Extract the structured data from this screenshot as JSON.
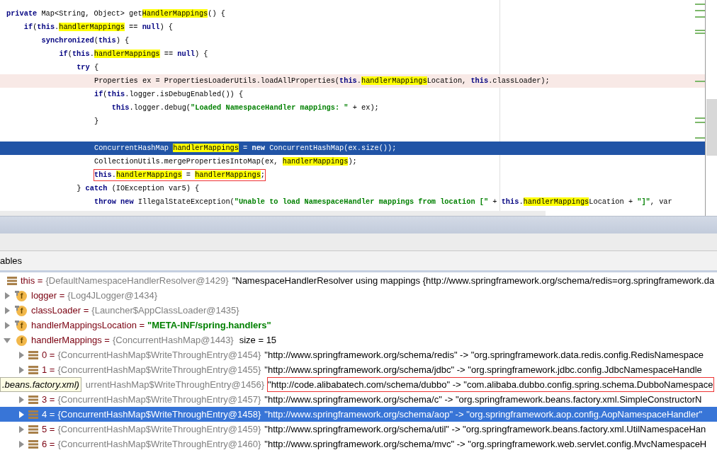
{
  "editor": {
    "lines": [
      {
        "selected": false,
        "execution": false,
        "boxed": false,
        "tokens": [
          {
            "kind": "kw",
            "text": "private"
          },
          {
            "kind": "plain",
            "text": " Map<String, Object> get"
          },
          {
            "kind": "hl",
            "text": "HandlerMappings"
          },
          {
            "kind": "plain",
            "text": "() {"
          }
        ],
        "children": [
          {
            "selected": false,
            "execution": false,
            "boxed": false,
            "tokens": [
              {
                "kind": "kw",
                "text": "if"
              },
              {
                "kind": "plain",
                "text": "("
              },
              {
                "kind": "kw",
                "text": "this"
              },
              {
                "kind": "plain",
                "text": "."
              },
              {
                "kind": "hl",
                "text": "handlerMappings"
              },
              {
                "kind": "plain",
                "text": " == "
              },
              {
                "kind": "kw",
                "text": "null"
              },
              {
                "kind": "plain",
                "text": ") {"
              }
            ],
            "children": [
              {
                "selected": false,
                "execution": false,
                "boxed": false,
                "tokens": [
                  {
                    "kind": "kw",
                    "text": "synchronized"
                  },
                  {
                    "kind": "plain",
                    "text": "("
                  },
                  {
                    "kind": "kw",
                    "text": "this"
                  },
                  {
                    "kind": "plain",
                    "text": ") {"
                  }
                ],
                "children": [
                  {
                    "selected": false,
                    "execution": false,
                    "boxed": false,
                    "tokens": [
                      {
                        "kind": "kw",
                        "text": "if"
                      },
                      {
                        "kind": "plain",
                        "text": "("
                      },
                      {
                        "kind": "kw",
                        "text": "this"
                      },
                      {
                        "kind": "plain",
                        "text": "."
                      },
                      {
                        "kind": "hl",
                        "text": "handlerMappings"
                      },
                      {
                        "kind": "plain",
                        "text": " == "
                      },
                      {
                        "kind": "kw",
                        "text": "null"
                      },
                      {
                        "kind": "plain",
                        "text": ") {"
                      }
                    ],
                    "children": [
                      {
                        "selected": false,
                        "execution": false,
                        "boxed": false,
                        "tokens": [
                          {
                            "kind": "kw",
                            "text": "try"
                          },
                          {
                            "kind": "plain",
                            "text": " {"
                          }
                        ],
                        "children": [
                          {
                            "selected": false,
                            "execution": true,
                            "boxed": false,
                            "tokens": [
                              {
                                "kind": "plain",
                                "text": "Properties ex = PropertiesLoaderUtils.loadAllProperties("
                              },
                              {
                                "kind": "kw",
                                "text": "this"
                              },
                              {
                                "kind": "plain",
                                "text": "."
                              },
                              {
                                "kind": "hl",
                                "text": "handlerMappings"
                              },
                              {
                                "kind": "plain",
                                "text": "Location, "
                              },
                              {
                                "kind": "kw",
                                "text": "this"
                              },
                              {
                                "kind": "plain",
                                "text": ".classLoader);"
                              }
                            ]
                          },
                          {
                            "selected": false,
                            "execution": false,
                            "boxed": false,
                            "tokens": [
                              {
                                "kind": "kw",
                                "text": "if"
                              },
                              {
                                "kind": "plain",
                                "text": "("
                              },
                              {
                                "kind": "kw",
                                "text": "this"
                              },
                              {
                                "kind": "plain",
                                "text": ".logger.isDebugEnabled()) {"
                              }
                            ],
                            "children": [
                              {
                                "selected": false,
                                "execution": false,
                                "boxed": false,
                                "tokens": [
                                  {
                                    "kind": "kw",
                                    "text": "this"
                                  },
                                  {
                                    "kind": "plain",
                                    "text": ".logger.debug("
                                  },
                                  {
                                    "kind": "str",
                                    "text": "\"Loaded NamespaceHandler mappings: \""
                                  },
                                  {
                                    "kind": "plain",
                                    "text": " + ex);"
                                  }
                                ]
                              }
                            ]
                          },
                          {
                            "selected": false,
                            "execution": false,
                            "boxed": false,
                            "tokens": [
                              {
                                "kind": "plain",
                                "text": "}"
                              }
                            ]
                          },
                          {
                            "selected": false,
                            "execution": false,
                            "boxed": false
                          },
                          {
                            "selected": true,
                            "execution": false,
                            "boxed": false,
                            "tokens": [
                              {
                                "kind": "plain",
                                "text": "ConcurrentHashMap "
                              },
                              {
                                "kind": "hl",
                                "text": "handlerMappings"
                              },
                              {
                                "kind": "plain",
                                "text": " = "
                              },
                              {
                                "kind": "kw",
                                "text": "new"
                              },
                              {
                                "kind": "plain",
                                "text": " ConcurrentHashMap(ex.size());"
                              }
                            ]
                          },
                          {
                            "selected": false,
                            "execution": false,
                            "boxed": false,
                            "tokens": [
                              {
                                "kind": "plain",
                                "text": "CollectionUtils.mergePropertiesIntoMap(ex, "
                              },
                              {
                                "kind": "hl",
                                "text": "handlerMappings"
                              },
                              {
                                "kind": "plain",
                                "text": ");"
                              }
                            ]
                          },
                          {
                            "selected": false,
                            "execution": false,
                            "boxed": true,
                            "tokens": [
                              {
                                "kind": "kw",
                                "text": "this"
                              },
                              {
                                "kind": "plain",
                                "text": "."
                              },
                              {
                                "kind": "hl",
                                "text": "handlerMappings"
                              },
                              {
                                "kind": "plain",
                                "text": " = "
                              },
                              {
                                "kind": "hl",
                                "text": "handlerMappings"
                              },
                              {
                                "kind": "plain",
                                "text": ";"
                              }
                            ]
                          }
                        ]
                      },
                      {
                        "selected": false,
                        "execution": false,
                        "boxed": false,
                        "tokens": [
                          {
                            "kind": "plain",
                            "text": "} "
                          },
                          {
                            "kind": "kw",
                            "text": "catch"
                          },
                          {
                            "kind": "plain",
                            "text": " (IOException var5) {"
                          }
                        ],
                        "children": [
                          {
                            "selected": false,
                            "execution": false,
                            "boxed": false,
                            "tokens": [
                              {
                                "kind": "kw",
                                "text": "throw new"
                              },
                              {
                                "kind": "plain",
                                "text": " IllegalStateException("
                              },
                              {
                                "kind": "str",
                                "text": "\"Unable to load NamespaceHandler mappings from location [\""
                              },
                              {
                                "kind": "plain",
                                "text": " + "
                              },
                              {
                                "kind": "kw",
                                "text": "this"
                              },
                              {
                                "kind": "plain",
                                "text": "."
                              },
                              {
                                "kind": "hl",
                                "text": "handlerMappings"
                              },
                              {
                                "kind": "plain",
                                "text": "Location + "
                              },
                              {
                                "kind": "str",
                                "text": "\"]\""
                              },
                              {
                                "kind": "plain",
                                "text": ", var"
                              }
                            ]
                          }
                        ]
                      }
                    ]
                  }
                ]
              }
            ]
          }
        ]
      }
    ]
  },
  "variables": {
    "title": "ables",
    "rows": [
      {
        "kind": "object",
        "selected": false,
        "boxed": false,
        "name": "this =",
        "type": "{DefaultNamespaceHandlerResolver@1429}",
        "value": "\"NamespaceHandlerResolver using mappings {http://www.springframework.org/schema/redis=org.springframework.da"
      },
      {
        "kind": "field",
        "badge": "f",
        "final": true,
        "expanded": false,
        "selected": false,
        "boxed": false,
        "name": "logger =",
        "type": "{Log4JLogger@1434}"
      },
      {
        "kind": "field",
        "badge": "f",
        "final": true,
        "expanded": false,
        "selected": false,
        "boxed": false,
        "name": "classLoader =",
        "type": "{Launcher$AppClassLoader@1435}"
      },
      {
        "kind": "field",
        "badge": "f",
        "final": true,
        "expanded": false,
        "selected": false,
        "boxed": false,
        "name": "handlerMappingsLocation =",
        "string": "\"META-INF/spring.handlers\""
      },
      {
        "kind": "field",
        "badge": "f",
        "final": false,
        "expanded": true,
        "selected": false,
        "boxed": false,
        "name": "handlerMappings =",
        "type": "{ConcurrentHashMap@1443}",
        "extra": "size = 15",
        "children": [
          {
            "kind": "object",
            "expanded": false,
            "selected": false,
            "boxed": false,
            "name": "0 =",
            "type": "{ConcurrentHashMap$WriteThroughEntry@1454}",
            "value": "\"http://www.springframework.org/schema/redis\" -> \"org.springframework.data.redis.config.RedisNamespace"
          },
          {
            "kind": "object",
            "expanded": false,
            "selected": false,
            "boxed": false,
            "name": "1 =",
            "type": "{ConcurrentHashMap$WriteThroughEntry@1455}",
            "value": "\"http://www.springframework.org/schema/jdbc\" -> \"org.springframework.jdbc.config.JdbcNamespaceHandle"
          },
          {
            "tooltip": ".beans.factory.xml)",
            "selected": false,
            "boxed": true,
            "type": "urrentHashMap$WriteThroughEntry@1456}",
            "value": "\"http://code.alibabatech.com/schema/dubbo\" -> \"com.alibaba.dubbo.config.spring.schema.DubboNamespace"
          },
          {
            "kind": "object",
            "expanded": false,
            "selected": false,
            "boxed": false,
            "name": "3 =",
            "type": "{ConcurrentHashMap$WriteThroughEntry@1457}",
            "value": "\"http://www.springframework.org/schema/c\" -> \"org.springframework.beans.factory.xml.SimpleConstructorN"
          },
          {
            "kind": "object",
            "expanded": false,
            "selected": true,
            "boxed": false,
            "name": "4 =",
            "type": "{ConcurrentHashMap$WriteThroughEntry@1458}",
            "value": "\"http://www.springframework.org/schema/aop\" -> \"org.springframework.aop.config.AopNamespaceHandler\""
          },
          {
            "kind": "object",
            "expanded": false,
            "selected": false,
            "boxed": false,
            "name": "5 =",
            "type": "{ConcurrentHashMap$WriteThroughEntry@1459}",
            "value": "\"http://www.springframework.org/schema/util\" -> \"org.springframework.beans.factory.xml.UtilNamespaceHan"
          },
          {
            "kind": "object",
            "expanded": false,
            "selected": false,
            "boxed": false,
            "name": "6 =",
            "type": "{ConcurrentHashMap$WriteThroughEntry@1460}",
            "value": "\"http://www.springframework.org/schema/mvc\" -> \"org.springframework.web.servlet.config.MvcNamespaceH"
          }
        ]
      }
    ]
  }
}
